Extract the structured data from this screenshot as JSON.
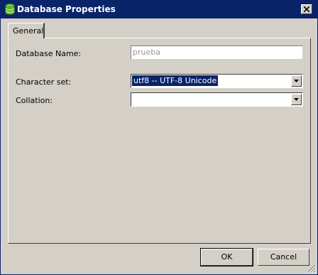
{
  "window": {
    "title": "Database Properties",
    "title_icon": "database-icon",
    "titlebar_color": "#0a246a"
  },
  "tabs": [
    {
      "label": "General",
      "active": true
    }
  ],
  "form": {
    "database_name_label": "Database Name:",
    "database_name_value": "prueba",
    "character_set_label": "Character set:",
    "character_set_value": "utf8 -- UTF-8 Unicode",
    "collation_label": "Collation:",
    "collation_value": ""
  },
  "buttons": {
    "ok": "OK",
    "cancel": "Cancel"
  },
  "icons": {
    "close": "close-icon",
    "dropdown": "chevron-down-icon",
    "resize": "resize-grip-icon"
  }
}
